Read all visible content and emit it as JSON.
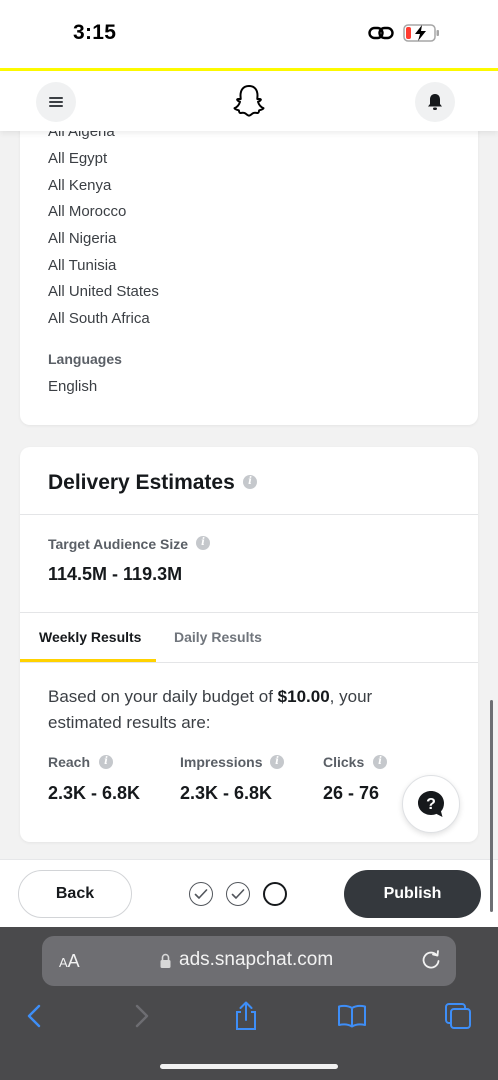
{
  "status_bar": {
    "time": "3:15"
  },
  "locations": [
    "All Algeria",
    "All Egypt",
    "All Kenya",
    "All Morocco",
    "All Nigeria",
    "All Tunisia",
    "All United States",
    "All South Africa"
  ],
  "languages": {
    "title": "Languages",
    "value": "English"
  },
  "delivery": {
    "title": "Delivery Estimates",
    "audience_label": "Target Audience Size",
    "audience_value": "114.5M - 119.3M",
    "tabs": [
      "Weekly Results",
      "Daily Results"
    ],
    "active_tab": "Weekly Results",
    "budget_prefix": "Based on your daily budget of ",
    "budget_amount": "$10.00",
    "budget_suffix": ", your estimated results are:",
    "metrics": [
      {
        "label": "Reach",
        "value": "2.3K - 6.8K"
      },
      {
        "label": "Impressions",
        "value": "2.3K - 6.8K"
      },
      {
        "label": "Clicks",
        "value": "26 - 76"
      }
    ]
  },
  "actions": {
    "back": "Back",
    "publish": "Publish"
  },
  "browser": {
    "aa_large": "A",
    "aa_small": "A",
    "url": "ads.snapchat.com"
  },
  "colors": {
    "accent_yellow": "#fffc00",
    "tab_underline": "#ffd200",
    "publish_bg": "#34383d"
  }
}
